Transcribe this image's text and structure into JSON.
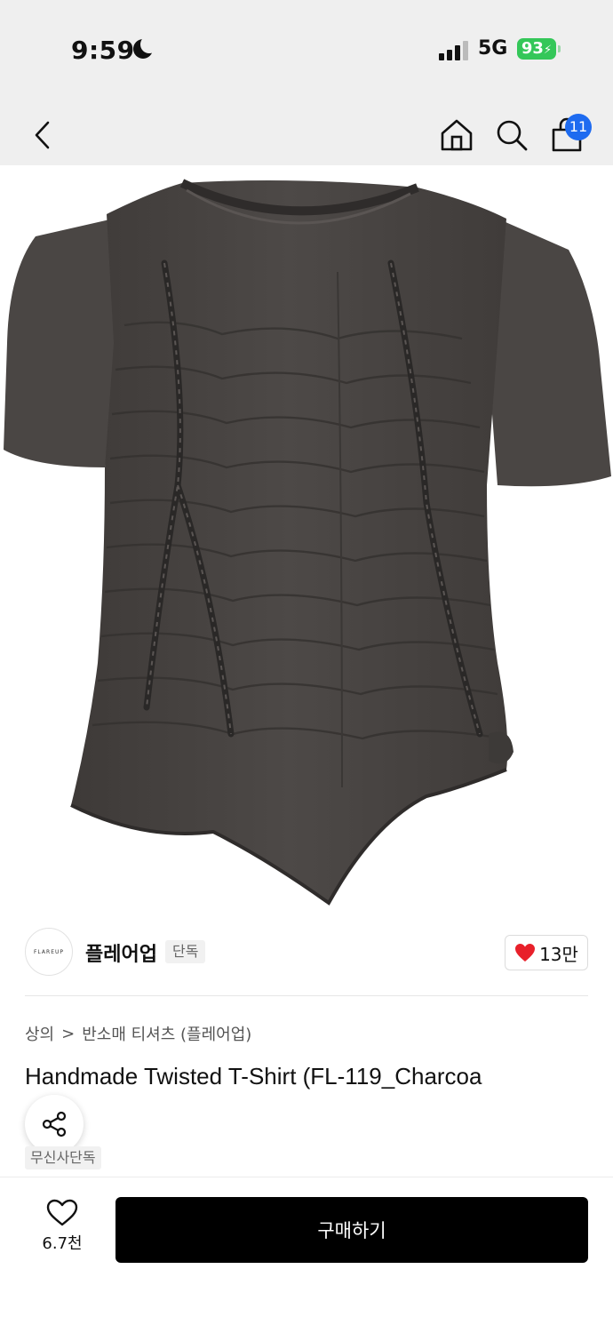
{
  "status_bar": {
    "time": "9:59",
    "network": "5G",
    "battery": "93"
  },
  "nav": {
    "cart_count": "11"
  },
  "brand": {
    "logo_text": "FLAREUP",
    "name": "플레어업",
    "exclusive_tag": "단독",
    "like_count": "13만"
  },
  "breadcrumb": {
    "category": "상의",
    "separator": ">",
    "subcategory": "반소매 티셔츠 (플레어업)"
  },
  "product": {
    "title": "Handmade Twisted T-Shirt (FL-119_Charcoa",
    "exclusive_badge": "무신사단독"
  },
  "bottom_bar": {
    "wish_count": "6.7천",
    "buy_label": "구매하기"
  },
  "colors": {
    "garment": "#4a4644",
    "accent_badge": "#1e6bf0",
    "battery": "#34c759",
    "heart": "#e8202a"
  }
}
